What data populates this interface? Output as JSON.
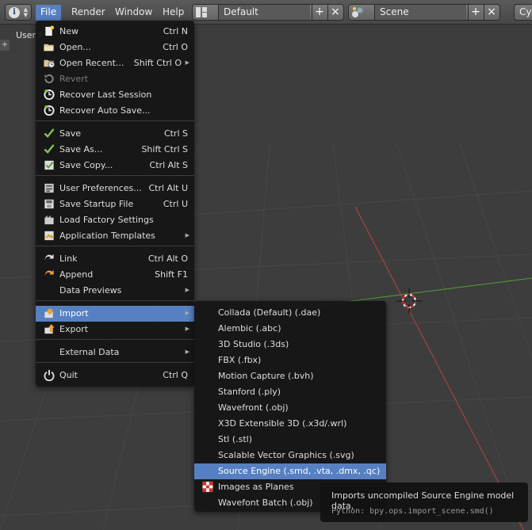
{
  "topbar": {
    "menus": [
      "File",
      "Render",
      "Window",
      "Help"
    ],
    "screen_layout": "Default",
    "scene": "Scene",
    "renderer_partial": "Cyc"
  },
  "viewport": {
    "label": "User P"
  },
  "file_menu": {
    "items": [
      {
        "label": "New",
        "shortcut": "Ctrl N",
        "icon": "new-file-icon"
      },
      {
        "label": "Open...",
        "shortcut": "Ctrl O",
        "icon": "folder-open-icon"
      },
      {
        "label": "Open Recent...",
        "shortcut": "Shift Ctrl O",
        "icon": "open-recent-icon",
        "submenu": true
      },
      {
        "label": "Revert",
        "shortcut": "",
        "icon": "revert-icon",
        "disabled": true
      },
      {
        "label": "Recover Last Session",
        "shortcut": "",
        "icon": "recover-icon"
      },
      {
        "label": "Recover Auto Save...",
        "shortcut": "",
        "icon": "recover-icon"
      },
      {
        "label": "Save",
        "shortcut": "Ctrl S",
        "icon": "checkmark-icon"
      },
      {
        "label": "Save As...",
        "shortcut": "Shift Ctrl S",
        "icon": "checkmark-icon"
      },
      {
        "label": "Save Copy...",
        "shortcut": "Ctrl Alt S",
        "icon": "save-copy-icon"
      },
      {
        "label": "User Preferences...",
        "shortcut": "Ctrl Alt U",
        "icon": "preferences-icon"
      },
      {
        "label": "Save Startup File",
        "shortcut": "Ctrl U",
        "icon": "save-startup-icon"
      },
      {
        "label": "Load Factory Settings",
        "shortcut": "",
        "icon": "factory-settings-icon"
      },
      {
        "label": "Application Templates",
        "shortcut": "",
        "icon": "templates-icon",
        "submenu": true
      },
      {
        "label": "Link",
        "shortcut": "Ctrl Alt O",
        "icon": "link-icon"
      },
      {
        "label": "Append",
        "shortcut": "Shift F1",
        "icon": "append-icon"
      },
      {
        "label": "Data Previews",
        "shortcut": "",
        "icon": "",
        "submenu": true
      },
      {
        "label": "Import",
        "shortcut": "",
        "icon": "import-icon",
        "submenu": true,
        "highlighted": true
      },
      {
        "label": "Export",
        "shortcut": "",
        "icon": "export-icon",
        "submenu": true
      },
      {
        "label": "External Data",
        "shortcut": "",
        "icon": "",
        "submenu": true
      },
      {
        "label": "Quit",
        "shortcut": "Ctrl Q",
        "icon": "power-icon"
      }
    ]
  },
  "import_menu": {
    "items": [
      {
        "label": "Collada (Default) (.dae)"
      },
      {
        "label": "Alembic (.abc)"
      },
      {
        "label": "3D Studio (.3ds)"
      },
      {
        "label": "FBX (.fbx)"
      },
      {
        "label": "Motion Capture (.bvh)"
      },
      {
        "label": "Stanford (.ply)"
      },
      {
        "label": "Wavefront (.obj)"
      },
      {
        "label": "X3D Extensible 3D (.x3d/.wrl)"
      },
      {
        "label": "Stl (.stl)"
      },
      {
        "label": "Scalable Vector Graphics (.svg)"
      },
      {
        "label": "Source Engine (.smd, .vta, .dmx, .qc)",
        "highlighted": true
      },
      {
        "label": "Images as Planes",
        "icon": "checker-icon"
      },
      {
        "label": "Wavefont Batch (.obj)"
      }
    ]
  },
  "tooltip": {
    "description": "Imports uncompiled Source Engine model data.",
    "python": "Python: bpy.ops.import_scene.smd()"
  },
  "colors": {
    "highlight": "#5680c2",
    "menu_bg": "#141414",
    "viewport_bg": "#3d3d3d",
    "x_axis": "#b84040",
    "y_axis": "#58a030"
  }
}
